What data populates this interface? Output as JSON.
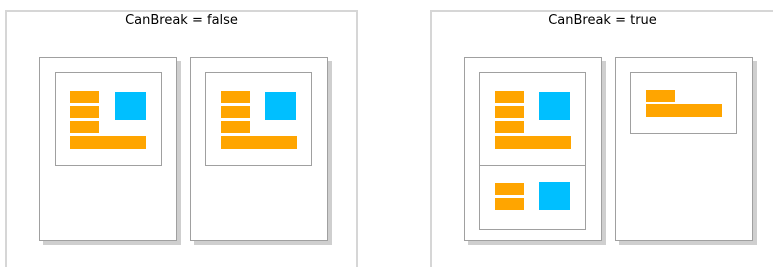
{
  "panels": {
    "left": {
      "title": "CanBreak = false"
    },
    "right": {
      "title": "CanBreak = true"
    }
  },
  "colors": {
    "orange": "#ffa500",
    "cyan": "#00bfff",
    "border": "#a0a0a0",
    "shadow": "#cfcfcf",
    "panel_border": "#d6d6d6"
  }
}
